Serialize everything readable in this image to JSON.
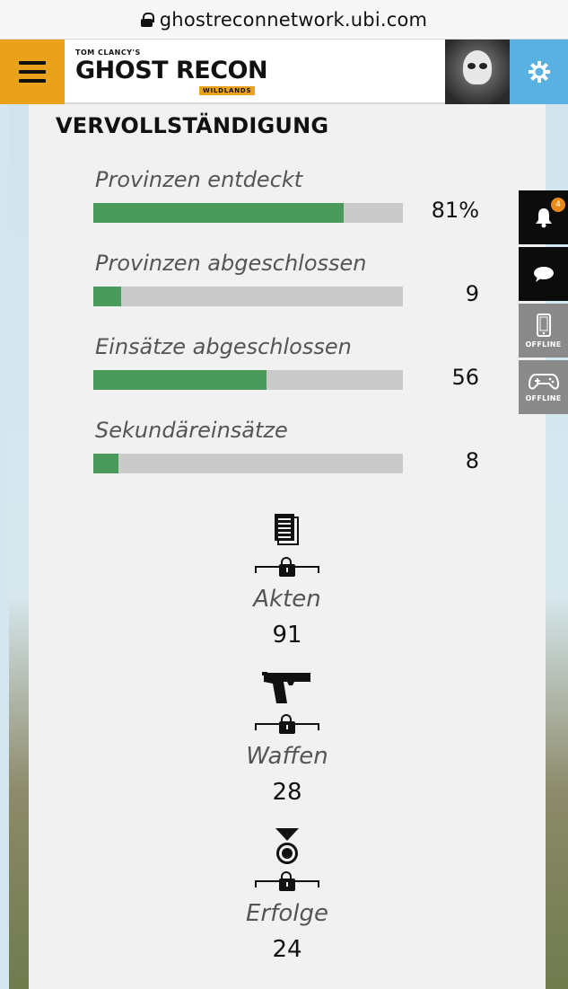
{
  "browser": {
    "url": "ghostreconnetwork.ubi.com"
  },
  "header": {
    "logo_small": "TOM CLANCY'S",
    "logo_big": "GHOST RECON",
    "logo_sub": "WILDLANDS",
    "colors": {
      "menu": "#e9a21a",
      "settings": "#5ab0e0"
    }
  },
  "section": {
    "title": "VERVOLLSTÄNDIGUNG"
  },
  "stats": [
    {
      "label": "Provinzen entdeckt",
      "value": "81%",
      "fill": 0.81
    },
    {
      "label": "Provinzen abgeschlossen",
      "value": "9",
      "fill": 0.09
    },
    {
      "label": "Einsätze abgeschlossen",
      "value": "56",
      "fill": 0.56
    },
    {
      "label": "Sekundäreinsätze",
      "value": "8",
      "fill": 0.08
    }
  ],
  "collectibles": [
    {
      "name": "Akten",
      "count": "91",
      "icon": "documents-icon"
    },
    {
      "name": "Waffen",
      "count": "28",
      "icon": "pistol-icon"
    },
    {
      "name": "Erfolge",
      "count": "24",
      "icon": "medal-icon"
    }
  ],
  "toolbar": {
    "notifications_count": "4",
    "mobile_status": "OFFLINE",
    "console_status": "OFFLINE"
  },
  "colors": {
    "bar_fill": "#4a9a5b",
    "bar_track": "#cacaca"
  }
}
